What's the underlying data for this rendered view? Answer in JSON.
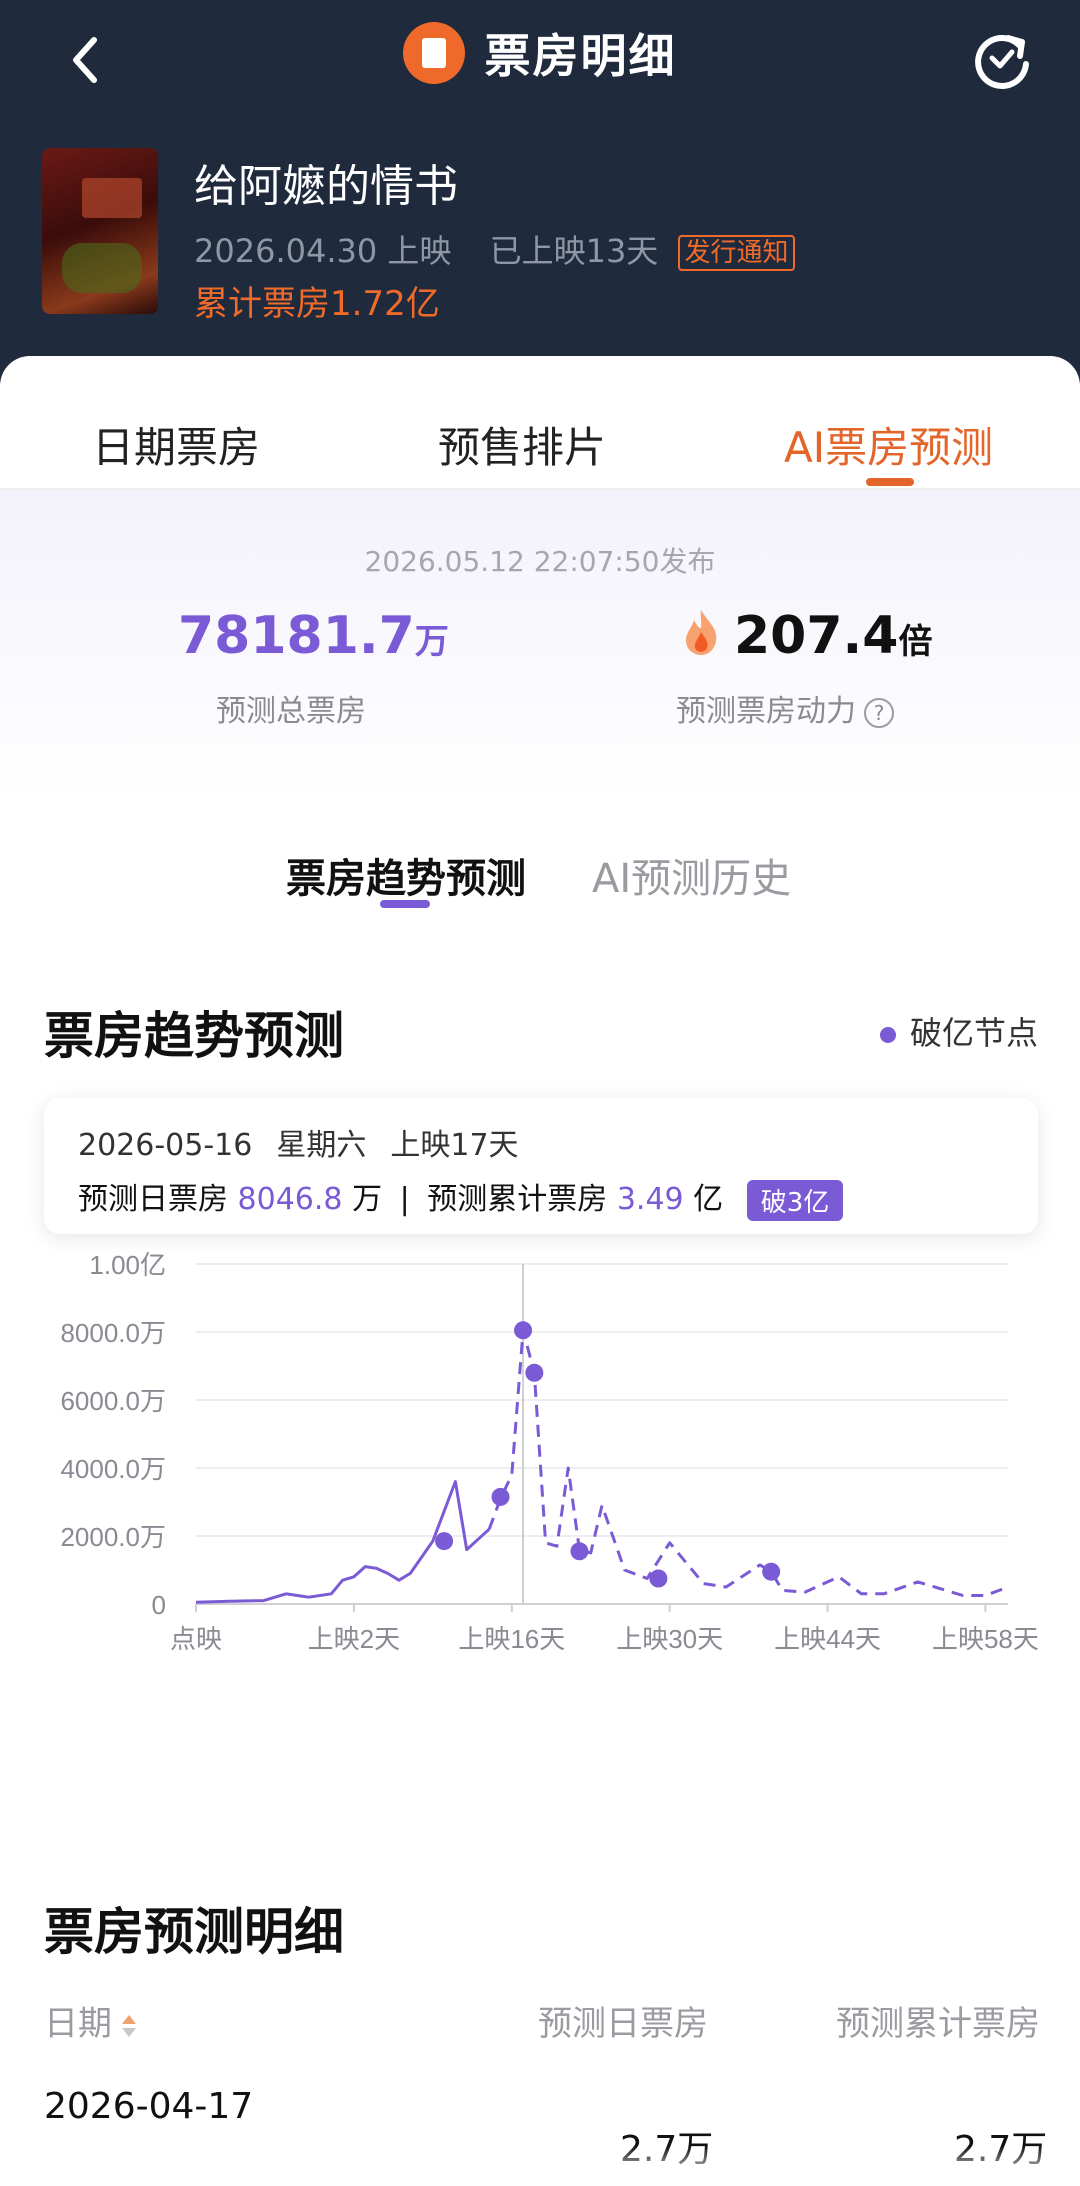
{
  "header": {
    "title": "票房明细"
  },
  "movie": {
    "title": "给阿嬷的情书",
    "release": "2026.04.30 上映",
    "days_shown": "已上映13天",
    "notice": "发行通知",
    "cumulative": "累计票房1.72亿"
  },
  "tabs": [
    "日期票房",
    "预售排片",
    "AI票房预测"
  ],
  "summary": {
    "published": "2026.05.12 22:07:50发布",
    "total_value": "78181.7",
    "total_unit": "万",
    "total_label": "预测总票房",
    "multiplier_value": "207.4",
    "multiplier_unit": "倍",
    "multiplier_label": "预测票房动力"
  },
  "subtabs": [
    "票房趋势预测",
    "AI预测历史"
  ],
  "trend": {
    "title": "票房趋势预测",
    "legend": "破亿节点"
  },
  "tooltip": {
    "date": "2026-05-16",
    "weekday": "星期六",
    "day": "上映17天",
    "daily_label": "预测日票房",
    "daily_value": "8046.8",
    "daily_unit": "万",
    "sep": "|",
    "cum_label": "预测累计票房",
    "cum_value": "3.49",
    "cum_unit": "亿",
    "badge": "破3亿"
  },
  "chart_data": {
    "type": "line",
    "y_ticks": [
      "0",
      "2000.0万",
      "4000.0万",
      "6000.0万",
      "8000.0万",
      "1.00亿"
    ],
    "ylim": [
      0,
      10000
    ],
    "x_ticks": [
      "点映",
      "上映2天",
      "上映16天",
      "上映30天",
      "上映44天",
      "上映58天"
    ],
    "grid": true,
    "series": [
      {
        "name": "",
        "style": "solid",
        "values": [
          [
            0,
            50
          ],
          [
            3,
            80
          ],
          [
            6,
            100
          ],
          [
            8,
            300
          ],
          [
            9,
            250
          ],
          [
            10,
            200
          ],
          [
            12,
            300
          ],
          [
            13,
            700
          ],
          [
            14,
            800
          ],
          [
            15,
            1100
          ],
          [
            16,
            1050
          ],
          [
            17,
            900
          ],
          [
            18,
            700
          ],
          [
            19,
            900
          ],
          [
            21,
            1850
          ],
          [
            23,
            3600
          ],
          [
            24,
            1600
          ],
          [
            26,
            2200
          ]
        ]
      },
      {
        "name": "",
        "style": "dashed",
        "values": [
          [
            26,
            2200
          ],
          [
            27,
            3100
          ],
          [
            28,
            3800
          ],
          [
            29,
            8050
          ],
          [
            30,
            6800
          ],
          [
            31,
            1800
          ],
          [
            32,
            1700
          ],
          [
            33,
            4000
          ],
          [
            34,
            1600
          ],
          [
            35,
            1500
          ],
          [
            36,
            2900
          ],
          [
            38,
            1000
          ],
          [
            40,
            750
          ],
          [
            42,
            1800
          ],
          [
            45,
            600
          ],
          [
            47,
            500
          ],
          [
            50,
            1150
          ],
          [
            51,
            950
          ],
          [
            52,
            400
          ],
          [
            54,
            350
          ],
          [
            57,
            800
          ],
          [
            59,
            300
          ],
          [
            61,
            300
          ],
          [
            64,
            650
          ],
          [
            66,
            450
          ],
          [
            68,
            250
          ],
          [
            70,
            250
          ],
          [
            72,
            500
          ]
        ]
      }
    ],
    "milestones": [
      [
        22,
        1850
      ],
      [
        27,
        3150
      ],
      [
        29,
        8050
      ],
      [
        30,
        6800
      ],
      [
        34,
        1550
      ],
      [
        41,
        750
      ],
      [
        51,
        950
      ]
    ],
    "cursor_x": 29
  },
  "detail": {
    "title": "票房预测明细",
    "col_date": "日期",
    "col_daily": "预测日票房",
    "col_cum": "预测累计票房",
    "rows": [
      {
        "date": "2026-04-17",
        "daily": "2.7万",
        "cum": "2.7万"
      }
    ]
  }
}
